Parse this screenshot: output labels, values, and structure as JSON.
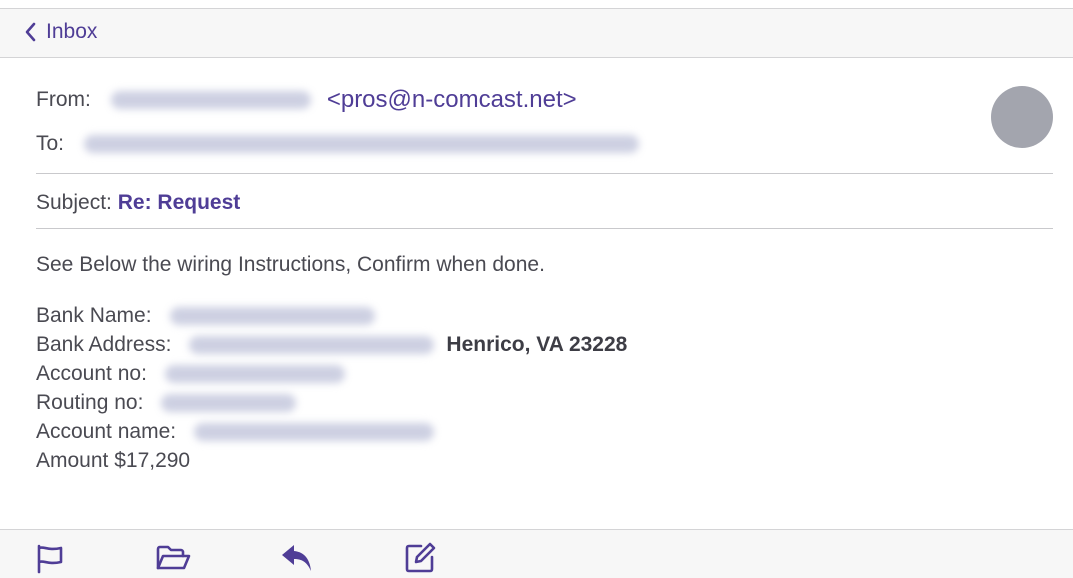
{
  "header": {
    "back_label": "Inbox"
  },
  "message": {
    "from_label": "From:",
    "from_email": "<pros@n-comcast.net>",
    "to_label": "To:",
    "subject_label": "Subject:",
    "subject": "Re: Request",
    "intro": "See Below the wiring Instructions, Confirm when done.",
    "details": {
      "bank_name_label": "Bank Name:",
      "bank_address_label": "Bank Address:",
      "bank_address_visible": "Henrico, VA 23228",
      "account_no_label": "Account no:",
      "routing_no_label": "Routing no:",
      "account_name_label": "Account name:",
      "amount": "Amount $17,290"
    }
  },
  "toolbar": {
    "icons": [
      "flag-icon",
      "folder-icon",
      "reply-icon",
      "compose-icon"
    ]
  },
  "colors": {
    "accent": "#4f3d96",
    "avatar": "#a3a5ae",
    "text": "#4a4a52"
  }
}
